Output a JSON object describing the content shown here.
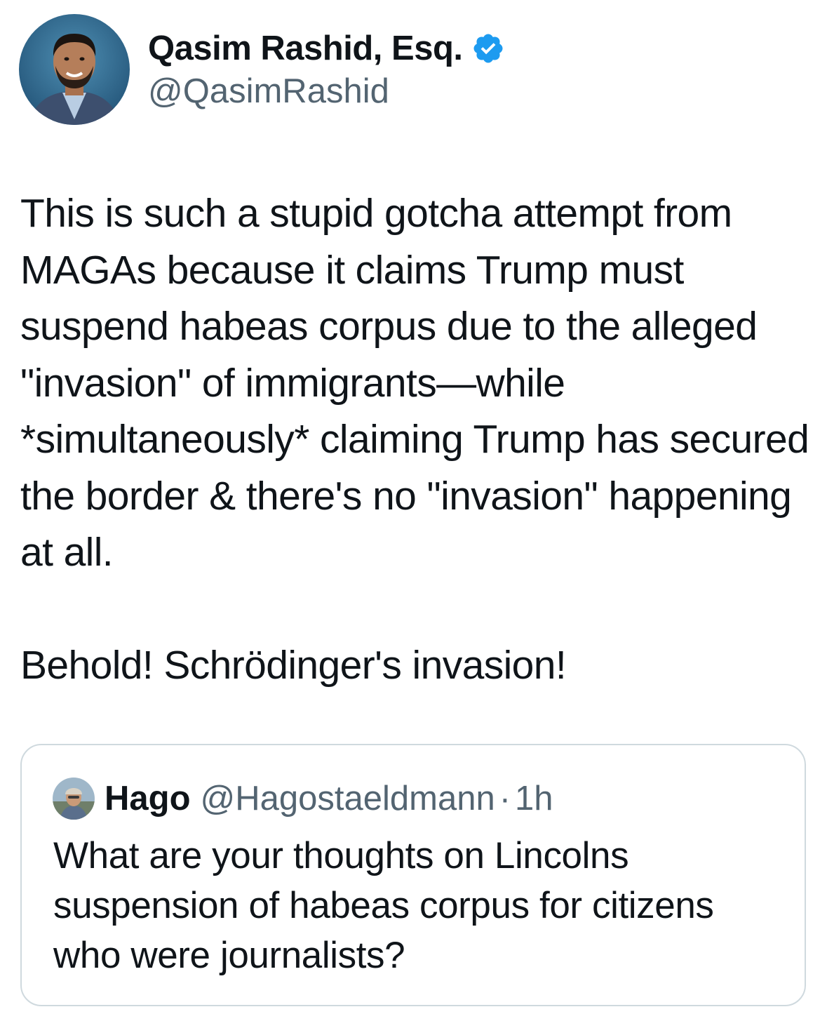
{
  "author": {
    "display_name": "Qasim Rashid, Esq.",
    "handle": "@QasimRashid",
    "verified": true,
    "avatar_icon": "profile-photo"
  },
  "tweet": {
    "paragraphs": [
      "This is such a stupid gotcha attempt from MAGAs because it claims Trump must suspend habeas corpus due to the alleged \"invasion\" of immigrants—while *simultaneously* claiming Trump has secured the border & there's no \"invasion\" happening at all.",
      "Behold! Schrödinger's invasion!"
    ]
  },
  "quoted_tweet": {
    "display_name": "Hago",
    "handle": "@Hagostaeldmann",
    "separator": "·",
    "time": "1h",
    "text": "What are your thoughts on Lincolns suspension of habeas corpus for citizens who were journalists?",
    "avatar_icon": "profile-photo"
  },
  "colors": {
    "text_primary": "#0f1419",
    "text_secondary": "#536471",
    "verified_blue": "#1d9bf0",
    "card_border": "#cfd9de"
  }
}
